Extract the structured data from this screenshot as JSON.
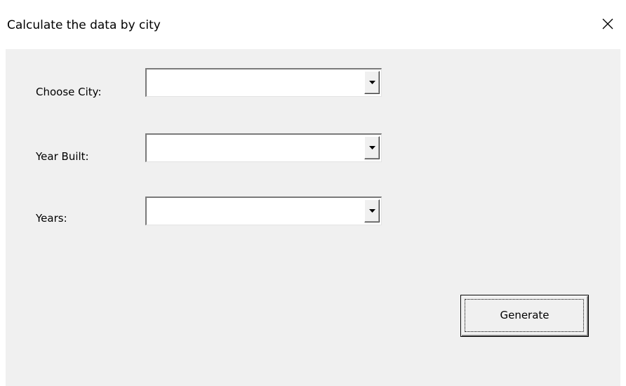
{
  "window": {
    "title": "Calculate the data by city",
    "close_icon": "close-icon"
  },
  "form": {
    "fields": [
      {
        "label": "Choose City:",
        "value": "",
        "arrow_icon": "dropdown-arrow-icon"
      },
      {
        "label": "Year Built:",
        "value": "",
        "arrow_icon": "dropdown-arrow-icon"
      },
      {
        "label": "Years:",
        "value": "",
        "arrow_icon": "dropdown-arrow-icon"
      }
    ],
    "generate_label": "Generate"
  },
  "colors": {
    "client_background": "#f0f0f0",
    "title_background": "#ffffff"
  }
}
